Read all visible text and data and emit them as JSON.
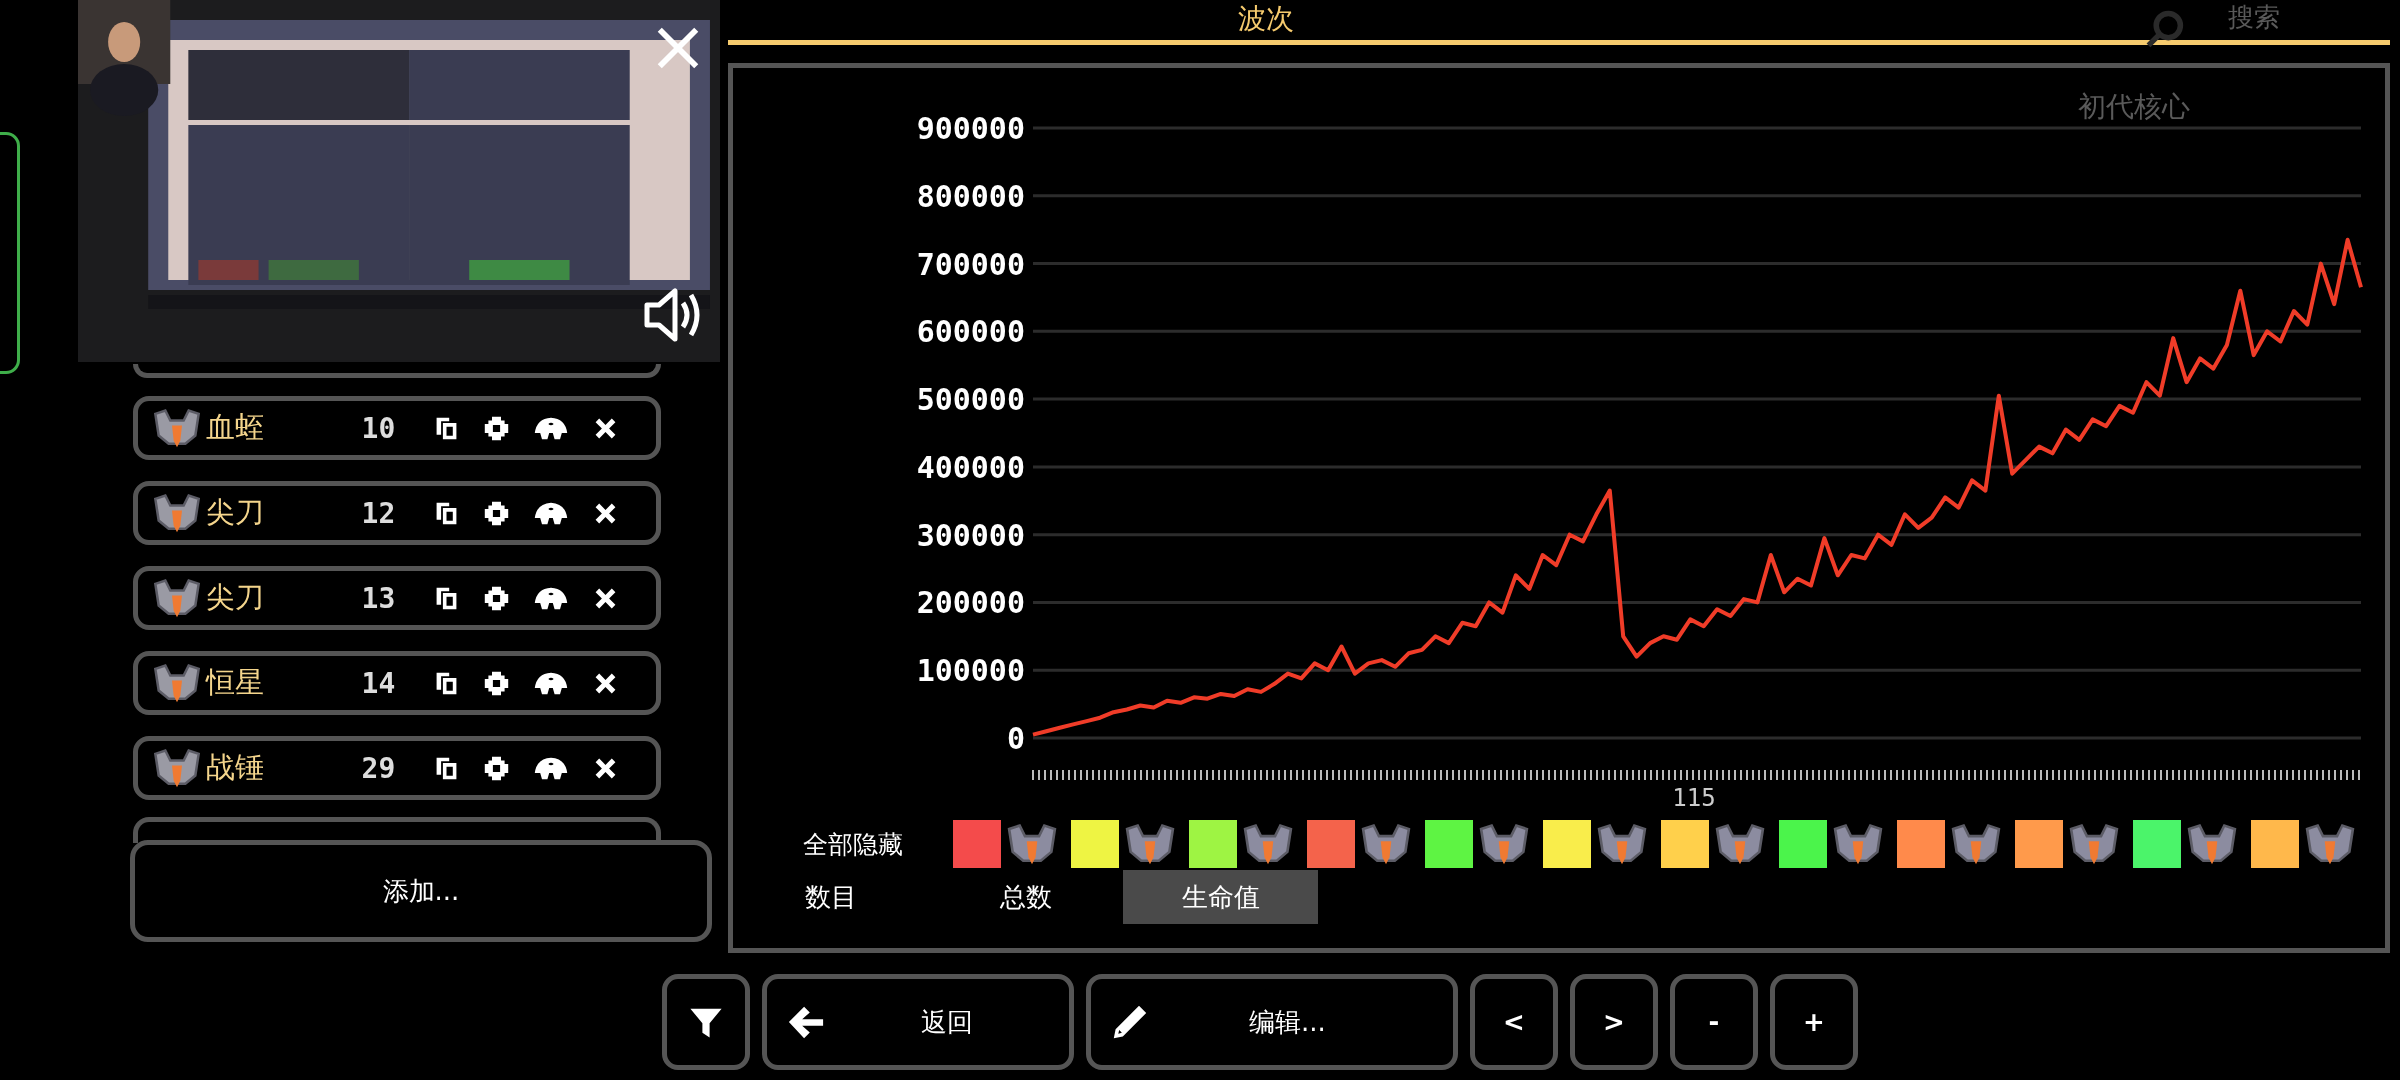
{
  "title": "波次",
  "background": {
    "search_label": "搜索",
    "core_label": "初代核心"
  },
  "waves": [
    {
      "name": "血蛭",
      "count": "10"
    },
    {
      "name": "尖刀",
      "count": "12"
    },
    {
      "name": "尖刀",
      "count": "13"
    },
    {
      "name": "恒星",
      "count": "14"
    },
    {
      "name": "战锤",
      "count": "29"
    }
  ],
  "add_button": "添加...",
  "legend_toggle": "全部隐藏",
  "legend": [
    {
      "color": "#f44b4b"
    },
    {
      "color": "#eef443"
    },
    {
      "color": "#9ef443"
    },
    {
      "color": "#f4634b"
    },
    {
      "color": "#5ef443"
    },
    {
      "color": "#f9ed4b"
    },
    {
      "color": "#ffd04b"
    },
    {
      "color": "#4bf44b"
    },
    {
      "color": "#ff8a4b"
    },
    {
      "color": "#ff9a4b"
    },
    {
      "color": "#4bf46a"
    },
    {
      "color": "#ffb84b"
    }
  ],
  "modes": [
    {
      "label": "数目",
      "selected": false
    },
    {
      "label": "总数",
      "selected": false
    },
    {
      "label": "生命值",
      "selected": true
    }
  ],
  "chart_data": {
    "type": "line",
    "grid": true,
    "xlabel": "115",
    "ylim": [
      0,
      900000
    ],
    "yticks": [
      0,
      100000,
      200000,
      300000,
      400000,
      500000,
      600000,
      700000,
      800000,
      900000
    ],
    "series": [
      {
        "color": "#f03c28",
        "values": [
          5000,
          10000,
          15000,
          20000,
          25000,
          30000,
          38000,
          42000,
          48000,
          45000,
          55000,
          52000,
          60000,
          58000,
          65000,
          62000,
          72000,
          68000,
          80000,
          95000,
          88000,
          110000,
          100000,
          135000,
          95000,
          110000,
          115000,
          105000,
          125000,
          130000,
          150000,
          140000,
          170000,
          165000,
          200000,
          185000,
          240000,
          220000,
          270000,
          255000,
          300000,
          290000,
          330000,
          365000,
          150000,
          120000,
          140000,
          150000,
          145000,
          175000,
          165000,
          190000,
          180000,
          205000,
          200000,
          270000,
          215000,
          235000,
          225000,
          295000,
          240000,
          270000,
          265000,
          300000,
          285000,
          330000,
          310000,
          325000,
          355000,
          340000,
          380000,
          365000,
          505000,
          390000,
          410000,
          430000,
          420000,
          455000,
          440000,
          470000,
          460000,
          490000,
          480000,
          525000,
          505000,
          590000,
          525000,
          560000,
          545000,
          580000,
          660000,
          565000,
          600000,
          585000,
          630000,
          610000,
          700000,
          640000,
          735000,
          665000
        ]
      }
    ]
  },
  "toolbar": {
    "back": "返回",
    "edit": "编辑...",
    "prev": "<",
    "next": ">",
    "minus": "-",
    "plus": "+"
  }
}
